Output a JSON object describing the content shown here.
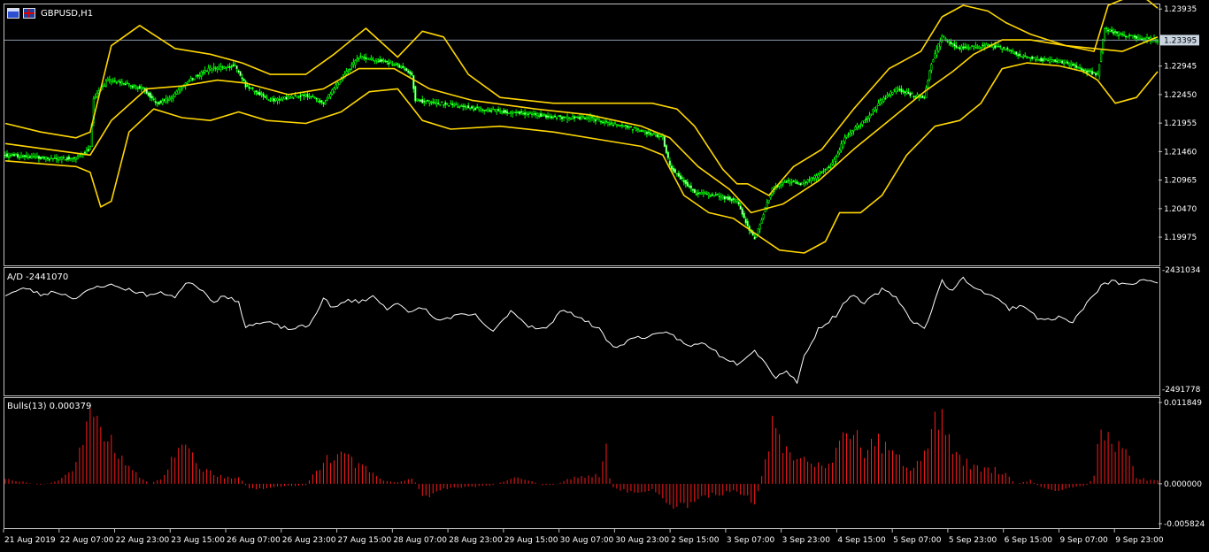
{
  "window": {
    "symbol_label": "GBPUSD,H1"
  },
  "colors": {
    "bull_candle": "#00ff00",
    "bear_candle": "#ffffff",
    "bands": "#ffd700",
    "ad_line": "#ffffff",
    "bulls_bars": "#ff1a1a",
    "grid_border": "#c0c0c0",
    "bid_line": "#8899aa",
    "background": "#000000"
  },
  "icons": [
    "chart-window-icon",
    "gb-flag-icon"
  ],
  "chart_data": [
    {
      "panel": "price",
      "type": "candlestick",
      "title": "GBPUSD,H1",
      "indicators": [
        "Bollinger Bands"
      ],
      "y_ticks": [
        "1.23935",
        "1.22945",
        "1.22450",
        "1.21955",
        "1.21460",
        "1.20965",
        "1.20470",
        "1.19975"
      ],
      "ylim": [
        1.195,
        1.24
      ],
      "current_price": "1.23395",
      "close_path": [
        [
          0,
          1.214
        ],
        [
          12,
          1.2138
        ],
        [
          26,
          1.2133
        ],
        [
          40,
          1.2135
        ],
        [
          48,
          1.2152
        ],
        [
          50,
          1.224
        ],
        [
          58,
          1.227
        ],
        [
          66,
          1.2265
        ],
        [
          78,
          1.2255
        ],
        [
          86,
          1.223
        ],
        [
          94,
          1.224
        ],
        [
          104,
          1.227
        ],
        [
          116,
          1.229
        ],
        [
          130,
          1.2295
        ],
        [
          136,
          1.226
        ],
        [
          150,
          1.2235
        ],
        [
          170,
          1.2245
        ],
        [
          180,
          1.223
        ],
        [
          192,
          1.228
        ],
        [
          200,
          1.231
        ],
        [
          210,
          1.2305
        ],
        [
          218,
          1.23
        ],
        [
          226,
          1.229
        ],
        [
          230,
          1.228
        ],
        [
          232,
          1.2235
        ],
        [
          244,
          1.223
        ],
        [
          258,
          1.2225
        ],
        [
          268,
          1.222
        ],
        [
          284,
          1.2215
        ],
        [
          300,
          1.221
        ],
        [
          316,
          1.2205
        ],
        [
          330,
          1.2205
        ],
        [
          342,
          1.2195
        ],
        [
          350,
          1.219
        ],
        [
          362,
          1.218
        ],
        [
          372,
          1.217
        ],
        [
          376,
          1.212
        ],
        [
          390,
          1.2075
        ],
        [
          402,
          1.207
        ],
        [
          414,
          1.206
        ],
        [
          420,
          1.2015
        ],
        [
          424,
          1.1995
        ],
        [
          428,
          1.203
        ],
        [
          434,
          1.208
        ],
        [
          440,
          1.2095
        ],
        [
          450,
          1.209
        ],
        [
          460,
          1.2105
        ],
        [
          468,
          1.2125
        ],
        [
          476,
          1.2175
        ],
        [
          486,
          1.22
        ],
        [
          496,
          1.2235
        ],
        [
          504,
          1.2255
        ],
        [
          512,
          1.2245
        ],
        [
          520,
          1.224
        ],
        [
          524,
          1.23
        ],
        [
          530,
          1.2345
        ],
        [
          540,
          1.2325
        ],
        [
          556,
          1.233
        ],
        [
          566,
          1.2325
        ],
        [
          576,
          1.231
        ],
        [
          588,
          1.2305
        ],
        [
          600,
          1.23
        ],
        [
          612,
          1.2285
        ],
        [
          618,
          1.228
        ],
        [
          622,
          1.236
        ],
        [
          630,
          1.235
        ],
        [
          642,
          1.2342
        ],
        [
          652,
          1.234
        ]
      ],
      "bands_upper": [
        [
          0,
          1.2195
        ],
        [
          20,
          1.218
        ],
        [
          40,
          1.217
        ],
        [
          48,
          1.218
        ],
        [
          60,
          1.233
        ],
        [
          76,
          1.2365
        ],
        [
          96,
          1.2325
        ],
        [
          116,
          1.2315
        ],
        [
          134,
          1.23
        ],
        [
          150,
          1.228
        ],
        [
          170,
          1.228
        ],
        [
          186,
          1.2315
        ],
        [
          204,
          1.236
        ],
        [
          222,
          1.231
        ],
        [
          236,
          1.2355
        ],
        [
          248,
          1.2345
        ],
        [
          262,
          1.228
        ],
        [
          280,
          1.224
        ],
        [
          310,
          1.223
        ],
        [
          350,
          1.223
        ],
        [
          366,
          1.223
        ],
        [
          380,
          1.222
        ],
        [
          390,
          1.219
        ],
        [
          406,
          1.2115
        ],
        [
          414,
          1.209
        ],
        [
          420,
          1.209
        ],
        [
          432,
          1.207
        ],
        [
          446,
          1.212
        ],
        [
          462,
          1.215
        ],
        [
          480,
          1.222
        ],
        [
          500,
          1.229
        ],
        [
          518,
          1.232
        ],
        [
          530,
          1.238
        ],
        [
          542,
          1.24
        ],
        [
          556,
          1.239
        ],
        [
          566,
          1.237
        ],
        [
          580,
          1.235
        ],
        [
          600,
          1.233
        ],
        [
          616,
          1.232
        ],
        [
          624,
          1.24
        ],
        [
          636,
          1.2415
        ],
        [
          646,
          1.241
        ],
        [
          652,
          1.2395
        ]
      ],
      "bands_middle": [
        [
          0,
          1.216
        ],
        [
          24,
          1.215
        ],
        [
          48,
          1.214
        ],
        [
          60,
          1.22
        ],
        [
          80,
          1.2255
        ],
        [
          100,
          1.226
        ],
        [
          120,
          1.227
        ],
        [
          136,
          1.2265
        ],
        [
          160,
          1.2245
        ],
        [
          180,
          1.2255
        ],
        [
          200,
          1.229
        ],
        [
          220,
          1.229
        ],
        [
          240,
          1.2255
        ],
        [
          264,
          1.2235
        ],
        [
          300,
          1.222
        ],
        [
          330,
          1.221
        ],
        [
          360,
          1.219
        ],
        [
          376,
          1.217
        ],
        [
          392,
          1.212
        ],
        [
          410,
          1.208
        ],
        [
          422,
          1.204
        ],
        [
          440,
          1.2055
        ],
        [
          460,
          1.2095
        ],
        [
          480,
          1.215
        ],
        [
          500,
          1.22
        ],
        [
          520,
          1.225
        ],
        [
          536,
          1.2285
        ],
        [
          548,
          1.2315
        ],
        [
          564,
          1.234
        ],
        [
          580,
          1.234
        ],
        [
          600,
          1.233
        ],
        [
          616,
          1.2325
        ],
        [
          632,
          1.232
        ],
        [
          652,
          1.2345
        ]
      ],
      "bands_lower": [
        [
          0,
          1.213
        ],
        [
          20,
          1.2125
        ],
        [
          40,
          1.212
        ],
        [
          48,
          1.211
        ],
        [
          54,
          1.205
        ],
        [
          60,
          1.206
        ],
        [
          70,
          1.218
        ],
        [
          84,
          1.222
        ],
        [
          100,
          1.2205
        ],
        [
          116,
          1.22
        ],
        [
          132,
          1.2215
        ],
        [
          148,
          1.22
        ],
        [
          170,
          1.2195
        ],
        [
          190,
          1.2215
        ],
        [
          206,
          1.225
        ],
        [
          222,
          1.2255
        ],
        [
          236,
          1.22
        ],
        [
          252,
          1.2185
        ],
        [
          280,
          1.219
        ],
        [
          310,
          1.218
        ],
        [
          340,
          1.2165
        ],
        [
          360,
          1.2155
        ],
        [
          372,
          1.214
        ],
        [
          384,
          1.207
        ],
        [
          398,
          1.204
        ],
        [
          412,
          1.203
        ],
        [
          426,
          1.2
        ],
        [
          438,
          1.1975
        ],
        [
          452,
          1.197
        ],
        [
          464,
          1.199
        ],
        [
          472,
          1.204
        ],
        [
          484,
          1.204
        ],
        [
          496,
          1.207
        ],
        [
          510,
          1.214
        ],
        [
          526,
          1.219
        ],
        [
          540,
          1.22
        ],
        [
          552,
          1.223
        ],
        [
          564,
          1.229
        ],
        [
          578,
          1.23
        ],
        [
          596,
          1.2295
        ],
        [
          610,
          1.2285
        ],
        [
          618,
          1.227
        ],
        [
          628,
          1.223
        ],
        [
          640,
          1.224
        ],
        [
          652,
          1.2285
        ]
      ]
    },
    {
      "panel": "ad",
      "type": "line",
      "title": "A/D -2441070",
      "y_ticks": [
        "-2431034",
        "-2491778"
      ],
      "ylim": [
        -2495000,
        -2428000
      ],
      "x": [
        0,
        12,
        20,
        28,
        40,
        50,
        58,
        70,
        80,
        90,
        96,
        104,
        110,
        118,
        124,
        132,
        136,
        148,
        160,
        172,
        180,
        186,
        194,
        200,
        208,
        216,
        222,
        228,
        236,
        244,
        256,
        266,
        276,
        286,
        296,
        306,
        316,
        326,
        336,
        344,
        356,
        366,
        376,
        386,
        396,
        404,
        414,
        424,
        430,
        436,
        442,
        448,
        452,
        460,
        470,
        478,
        486,
        496,
        504,
        512,
        520,
        530,
        536,
        542,
        550,
        558,
        568,
        576,
        586,
        596,
        604,
        612,
        620,
        626,
        634,
        644,
        652
      ],
      "y": [
        -2440000,
        -2436000,
        -2440000,
        -2438000,
        -2442000,
        -2436000,
        -2434000,
        -2437000,
        -2440000,
        -2439000,
        -2441000,
        -2432000,
        -2436000,
        -2444000,
        -2440000,
        -2445000,
        -2458000,
        -2456000,
        -2460000,
        -2458000,
        -2442000,
        -2448000,
        -2443000,
        -2444000,
        -2441000,
        -2448000,
        -2444000,
        -2451000,
        -2447000,
        -2455000,
        -2452000,
        -2452000,
        -2462000,
        -2449000,
        -2458000,
        -2460000,
        -2448000,
        -2454000,
        -2460000,
        -2471000,
        -2465000,
        -2464000,
        -2462000,
        -2470000,
        -2468000,
        -2475000,
        -2480000,
        -2472000,
        -2480000,
        -2488000,
        -2484000,
        -2491000,
        -2476000,
        -2460000,
        -2452000,
        -2440000,
        -2445000,
        -2437000,
        -2441000,
        -2454000,
        -2460000,
        -2432000,
        -2438000,
        -2430000,
        -2437000,
        -2440000,
        -2448000,
        -2446000,
        -2455000,
        -2453000,
        -2456000,
        -2445000,
        -2435000,
        -2432000,
        -2434000,
        -2432000,
        -2432000
      ]
    },
    {
      "panel": "bulls",
      "type": "bar",
      "title": "Bulls(13) 0.000379",
      "y_ticks": [
        "0.011849",
        "0.000000",
        "-0.005824"
      ],
      "ylim": [
        -0.005824,
        0.011849
      ],
      "anchors": [
        [
          0,
          0.0008
        ],
        [
          10,
          0.0003
        ],
        [
          20,
          -0.0002
        ],
        [
          30,
          0.0004
        ],
        [
          38,
          0.002
        ],
        [
          44,
          0.006
        ],
        [
          48,
          0.01
        ],
        [
          52,
          0.0098
        ],
        [
          56,
          0.0075
        ],
        [
          62,
          0.0055
        ],
        [
          70,
          0.0025
        ],
        [
          76,
          0.0008
        ],
        [
          82,
          0.0
        ],
        [
          88,
          0.0008
        ],
        [
          96,
          0.004
        ],
        [
          102,
          0.006
        ],
        [
          112,
          0.002
        ],
        [
          124,
          0.001
        ],
        [
          132,
          0.001
        ],
        [
          138,
          -0.0008
        ],
        [
          150,
          -0.0006
        ],
        [
          160,
          -0.0003
        ],
        [
          170,
          -0.0002
        ],
        [
          176,
          0.002
        ],
        [
          184,
          0.004
        ],
        [
          190,
          0.0055
        ],
        [
          198,
          0.003
        ],
        [
          208,
          0.0015
        ],
        [
          214,
          0.0005
        ],
        [
          222,
          0.0002
        ],
        [
          230,
          0.001
        ],
        [
          236,
          -0.0015
        ],
        [
          242,
          -0.0018
        ],
        [
          248,
          -0.0008
        ],
        [
          256,
          -0.0005
        ],
        [
          266,
          -0.0004
        ],
        [
          276,
          -0.0002
        ],
        [
          284,
          0.0005
        ],
        [
          290,
          0.001
        ],
        [
          296,
          0.0005
        ],
        [
          304,
          -0.0002
        ],
        [
          310,
          -0.0002
        ],
        [
          320,
          0.0008
        ],
        [
          326,
          0.001
        ],
        [
          336,
          0.0012
        ],
        [
          340,
          0.0055
        ],
        [
          342,
          0.001
        ],
        [
          344,
          -0.0005
        ],
        [
          350,
          -0.001
        ],
        [
          358,
          -0.0012
        ],
        [
          366,
          -0.001
        ],
        [
          372,
          -0.0018
        ],
        [
          378,
          -0.0038
        ],
        [
          386,
          -0.003
        ],
        [
          396,
          -0.002
        ],
        [
          404,
          -0.0015
        ],
        [
          412,
          -0.001
        ],
        [
          418,
          -0.002
        ],
        [
          424,
          -0.0028
        ],
        [
          428,
          0.001
        ],
        [
          434,
          0.008
        ],
        [
          442,
          0.005
        ],
        [
          450,
          0.0035
        ],
        [
          460,
          0.003
        ],
        [
          466,
          0.0025
        ],
        [
          470,
          0.005
        ],
        [
          476,
          0.008
        ],
        [
          480,
          0.0085
        ],
        [
          486,
          0.0045
        ],
        [
          494,
          0.006
        ],
        [
          500,
          0.005
        ],
        [
          506,
          0.0035
        ],
        [
          512,
          0.0025
        ],
        [
          518,
          0.004
        ],
        [
          524,
          0.007
        ],
        [
          528,
          0.0098
        ],
        [
          532,
          0.0085
        ],
        [
          538,
          0.004
        ],
        [
          544,
          0.003
        ],
        [
          552,
          0.002
        ],
        [
          560,
          0.002
        ],
        [
          566,
          0.0015
        ],
        [
          572,
          0.0
        ],
        [
          580,
          0.0005
        ],
        [
          586,
          -0.0005
        ],
        [
          592,
          -0.001
        ],
        [
          598,
          -0.0008
        ],
        [
          606,
          -0.0005
        ],
        [
          612,
          -0.0002
        ],
        [
          616,
          0.001
        ],
        [
          620,
          0.0085
        ],
        [
          626,
          0.006
        ],
        [
          634,
          0.0045
        ],
        [
          640,
          0.001
        ],
        [
          646,
          0.0005
        ],
        [
          652,
          0.0004
        ]
      ]
    }
  ],
  "x_axis_labels": [
    "21 Aug 2019",
    "22 Aug 07:00",
    "22 Aug 23:00",
    "23 Aug 15:00",
    "26 Aug 07:00",
    "26 Aug 23:00",
    "27 Aug 15:00",
    "28 Aug 07:00",
    "28 Aug 23:00",
    "29 Aug 15:00",
    "30 Aug 07:00",
    "30 Aug 23:00",
    "2 Sep 15:00",
    "3 Sep 07:00",
    "3 Sep 23:00",
    "4 Sep 15:00",
    "5 Sep 07:00",
    "5 Sep 23:00",
    "6 Sep 15:00",
    "9 Sep 07:00",
    "9 Sep 23:00"
  ]
}
